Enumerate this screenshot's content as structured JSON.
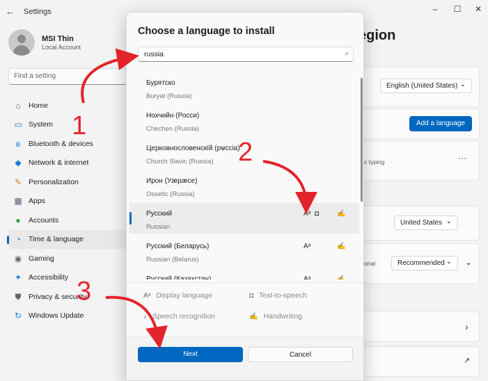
{
  "window": {
    "back_glyph": "←",
    "title": "Settings",
    "min_glyph": "–",
    "max_glyph": "☐",
    "close_glyph": "✕"
  },
  "user": {
    "name": "MSI Thin",
    "account": "Local Account"
  },
  "search_settings": {
    "placeholder": "Find a setting"
  },
  "nav": [
    {
      "label": "Home",
      "icon": "home-icon",
      "glyph": "⌂",
      "color": "#555555"
    },
    {
      "label": "System",
      "icon": "monitor-icon",
      "glyph": "▭",
      "color": "#1c7ed6"
    },
    {
      "label": "Bluetooth & devices",
      "icon": "bluetooth-icon",
      "glyph": "ʙ",
      "color": "#1c7ed6"
    },
    {
      "label": "Network & internet",
      "icon": "wifi-icon",
      "glyph": "◆",
      "color": "#1c7ed6"
    },
    {
      "label": "Personalization",
      "icon": "brush-icon",
      "glyph": "✎",
      "color": "#d9822b"
    },
    {
      "label": "Apps",
      "icon": "apps-icon",
      "glyph": "▦",
      "color": "#555f7a"
    },
    {
      "label": "Accounts",
      "icon": "person-icon",
      "glyph": "●",
      "color": "#2f9e44"
    },
    {
      "label": "Time & language",
      "icon": "globe-clock-icon",
      "glyph": "◔",
      "color": "#1c7ed6"
    },
    {
      "label": "Gaming",
      "icon": "gamepad-icon",
      "glyph": "◉",
      "color": "#666666"
    },
    {
      "label": "Accessibility",
      "icon": "accessibility-icon",
      "glyph": "✦",
      "color": "#1c7ed6"
    },
    {
      "label": "Privacy & security",
      "icon": "shield-icon",
      "glyph": "⛊",
      "color": "#666666"
    },
    {
      "label": "Windows Update",
      "icon": "update-icon",
      "glyph": "↻",
      "color": "#1c7ed6"
    }
  ],
  "background": {
    "page_title": "egion",
    "windows_display_language": "English (United States)",
    "add_language": "Add a language",
    "typing_hint": "c typing",
    "more_glyph": "···",
    "country": "United States",
    "regional_label": "onal",
    "regional_format": "Recommended",
    "dropdown_glyph": "⌄",
    "expand_glyph": "⌄",
    "chevron_glyph": "›",
    "external_glyph": "↗"
  },
  "dialog": {
    "title": "Choose a language to install",
    "search_value": "russia",
    "search_glyph": "⌕",
    "languages": [
      {
        "native": "Бурятско",
        "english": "Buryat (Russia)"
      },
      {
        "native": "Нохчийн (Росси)",
        "english": "Chechen (Russia)"
      },
      {
        "native": "Церковнословенскїй (рѡссіа)",
        "english": "Church Slavic (Russia)"
      },
      {
        "native": "Ирон (Уæрæсе)",
        "english": "Ossetic (Russia)"
      },
      {
        "native": "Русский",
        "english": "Russian",
        "selected": true
      },
      {
        "native": "Русский (Беларусь)",
        "english": "Russian (Belarus)"
      },
      {
        "native": "Русский (Казахстан)",
        "english": ""
      }
    ],
    "cap_glyphs": {
      "display": "Aᵃ",
      "tts": "◘",
      "handwriting": "✍"
    },
    "features": {
      "display_language": "Display language",
      "text_to_speech": "Text-to-speech",
      "speech_recognition": "Speech recognition",
      "handwriting": "Handwriting"
    },
    "feature_icons": {
      "display": "Aᵃ",
      "tts": "◘",
      "speech": "♪",
      "handwriting": "✍"
    },
    "next": "Next",
    "cancel": "Cancel"
  },
  "annotations": {
    "step1": "1",
    "step2": "2",
    "step3": "3",
    "color": "#e3242b"
  }
}
